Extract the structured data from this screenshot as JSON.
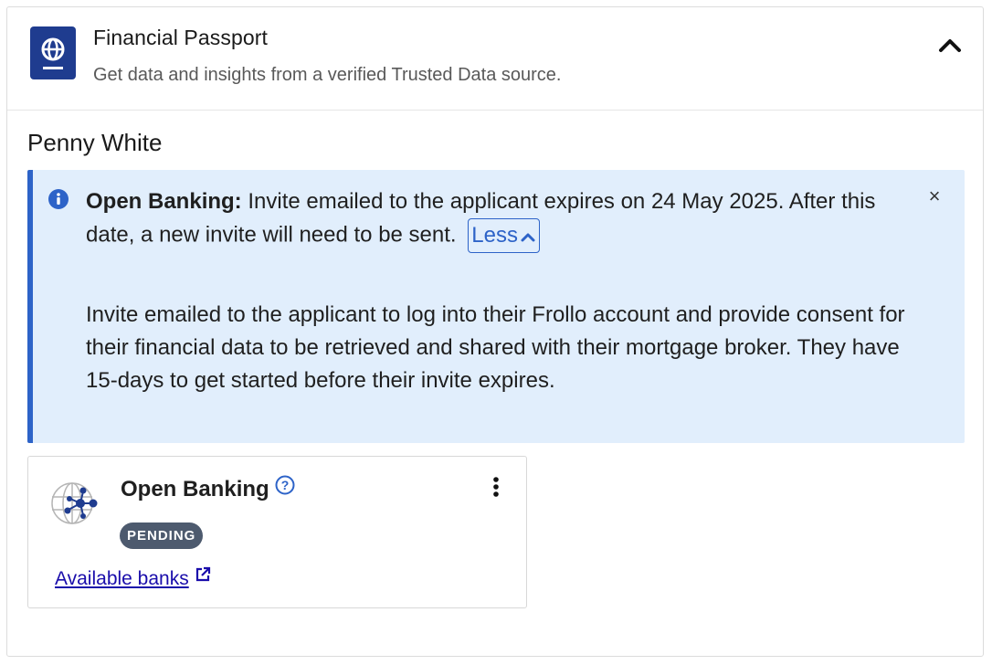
{
  "header": {
    "title": "Financial Passport",
    "subtitle": "Get data and insights from a verified Trusted Data source.",
    "icon": "passport-globe-icon",
    "collapse_icon": "chevron-up-icon",
    "accent_color": "#1f3c8f"
  },
  "applicant": {
    "name": "Penny White"
  },
  "alert": {
    "title": "Open Banking:",
    "message_line": "Invite emailed to the applicant expires on 24 May 2025. After this date, a new invite will need to be sent.",
    "toggle_label": "Less",
    "body": "Invite emailed to the applicant to log into their Frollo account and provide consent for their financial data to be retrieved and shared with their mortgage broker. They have 15-days to get started before their invite expires.",
    "close_symbol": "×",
    "background_color": "#e1eefc",
    "accent_color": "#2d63c8"
  },
  "card": {
    "title": "Open Banking",
    "status": "PENDING",
    "link_label": "Available banks",
    "status_color": "#4d5a6e",
    "link_color": "#1a0dab"
  }
}
